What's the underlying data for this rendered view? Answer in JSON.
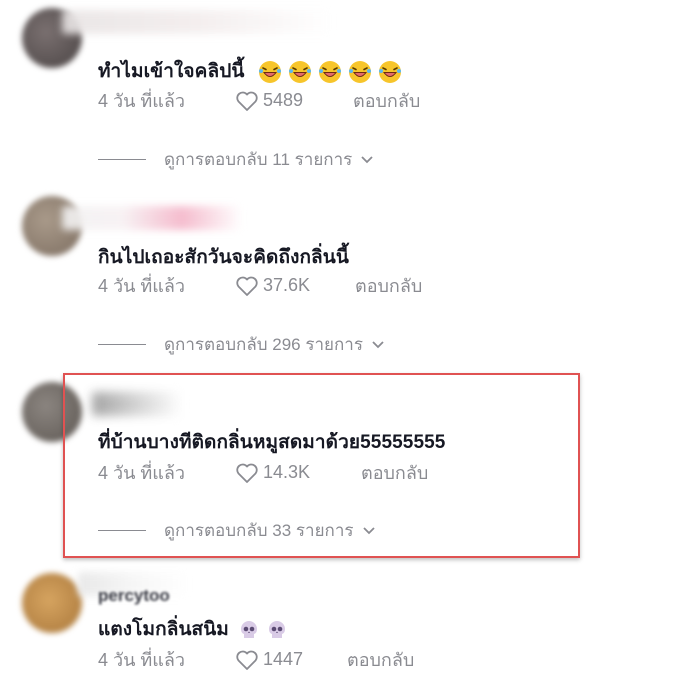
{
  "comments": [
    {
      "text": "ทำไมเข้าใจคลิปนี้",
      "emoji_count": 5,
      "time": "4 วัน ที่แล้ว",
      "likes": "5489",
      "reply_label": "ตอบกลับ",
      "view_replies": "ดูการตอบกลับ 11 รายการ"
    },
    {
      "text": "กินไปเถอะสักวันจะคิดถึงกลิ่นนี้",
      "time": "4 วัน ที่แล้ว",
      "likes": "37.6K",
      "reply_label": "ตอบกลับ",
      "view_replies": "ดูการตอบกลับ 296 รายการ"
    },
    {
      "text": "ที่บ้านบางทีติดกลิ่นหมูสดมาด้วย55555555",
      "time": "4 วัน ที่แล้ว",
      "likes": "14.3K",
      "reply_label": "ตอบกลับ",
      "view_replies": "ดูการตอบกลับ 33 รายการ"
    },
    {
      "username_partial": "percytoo",
      "text": "แตงโมกลิ่นสนิม",
      "emoji_count": 2,
      "time": "4 วัน ที่แล้ว",
      "likes": "1447",
      "reply_label": "ตอบกลับ"
    }
  ],
  "icons": {
    "like": "heart-outline-icon",
    "expand": "chevron-down-icon",
    "emoji_1": "laughing-emoji-icon",
    "emoji_4": "skull-emoji-icon"
  },
  "colors": {
    "highlight_border": "#e05252",
    "meta_text": "#8a8b91",
    "body_text": "#161823"
  }
}
